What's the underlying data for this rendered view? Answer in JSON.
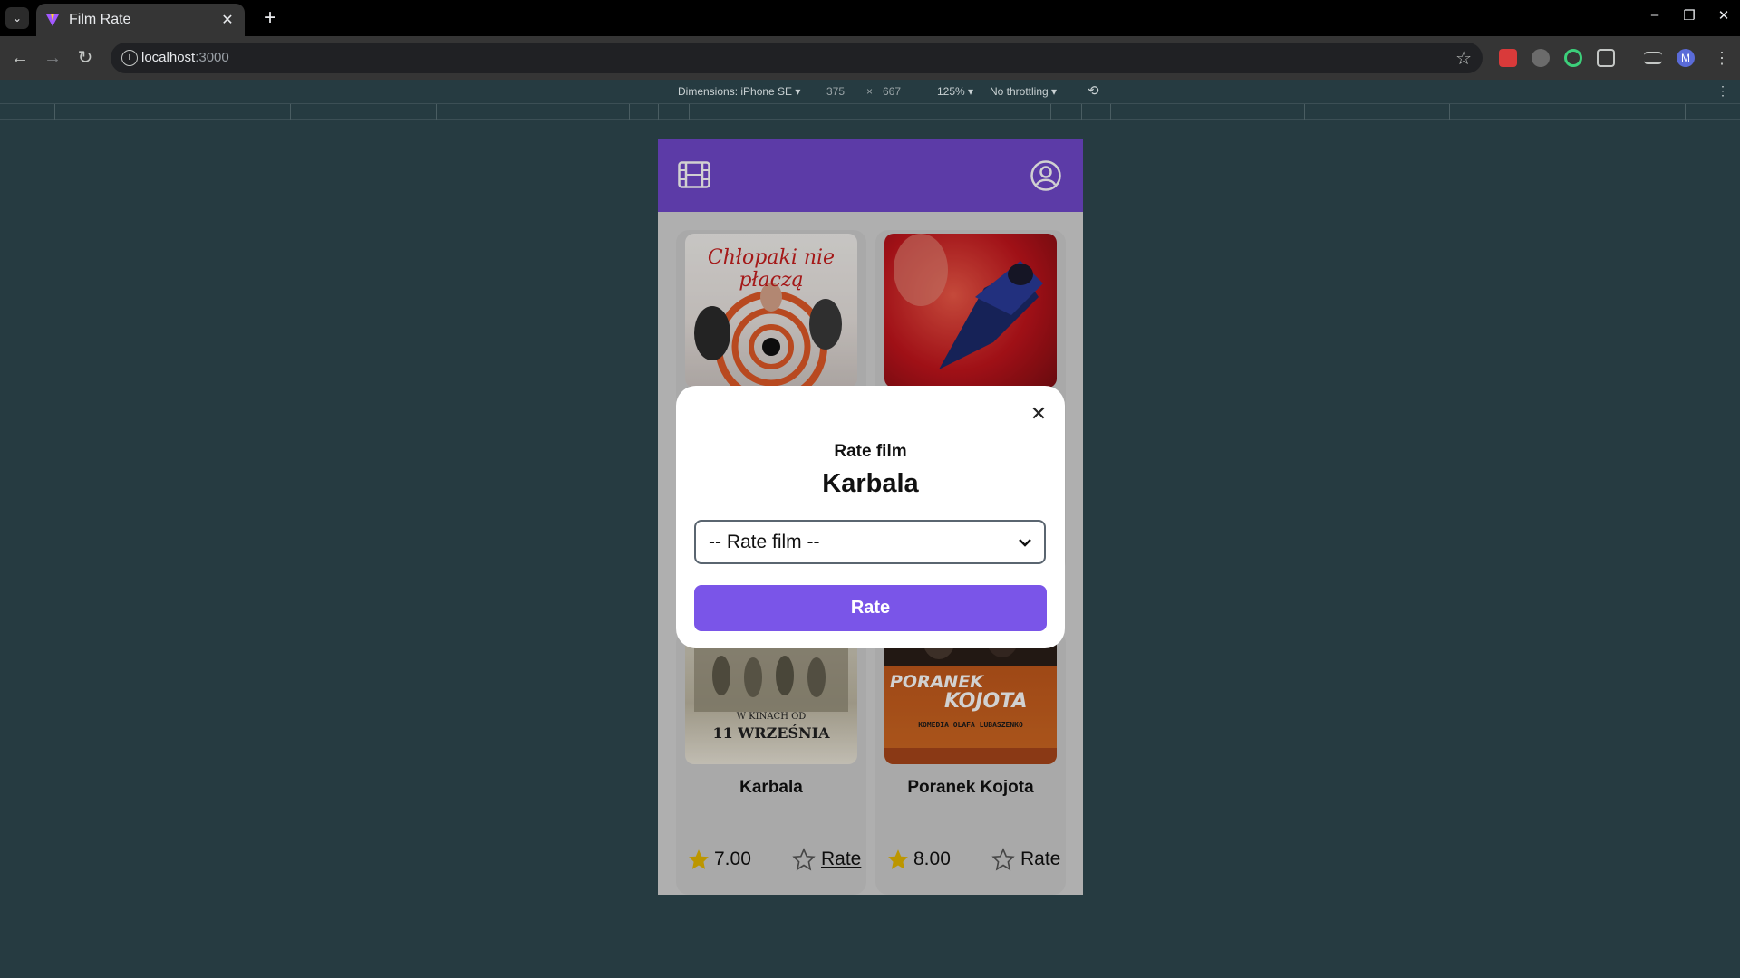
{
  "browser": {
    "tab_title": "Film Rate",
    "url_host": "localhost",
    "url_port": ":3000"
  },
  "devtools": {
    "dimensions_label": "Dimensions: iPhone SE",
    "width": "375",
    "times": "×",
    "height": "667",
    "zoom": "125%",
    "throttling": "No throttling"
  },
  "films": [
    {
      "title": "Chłopaki nie płaczą",
      "poster_text": "Chłopaki nie płaczą"
    },
    {
      "title": "",
      "poster_text": ""
    },
    {
      "title": "Karbala",
      "poster_text_line1": "W KINACH OD",
      "poster_text_line2": "11 WRZEŚNIA",
      "rating": "7.00",
      "rate_label": "Rate"
    },
    {
      "title": "Poranek Kojota",
      "poster_text_line1": "PORANEK",
      "poster_text_line2": "KOJOTA",
      "poster_text_line3": "KOMEDIA OLAFA LUBASZENKO",
      "rating": "8.00",
      "rate_label": "Rate"
    }
  ],
  "modal": {
    "subtitle": "Rate film",
    "film_title": "Karbala",
    "select_placeholder": "-- Rate film --",
    "submit_label": "Rate"
  },
  "colors": {
    "header": "#7148cc",
    "button": "#7a55e8",
    "star": "#e6b800"
  }
}
